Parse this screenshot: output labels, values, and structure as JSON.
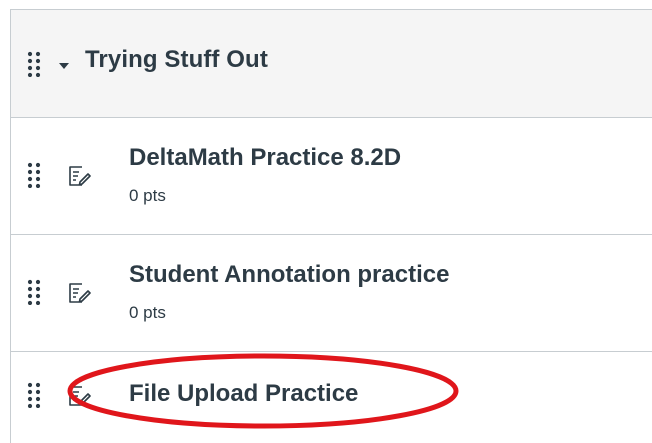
{
  "module": {
    "title": "Trying Stuff Out",
    "collapse_icon": "caret-down-icon",
    "drag_icon": "drag-handle-icon"
  },
  "items": [
    {
      "title": "DeltaMath Practice 8.2D",
      "points": "0 pts",
      "icon": "assignment-icon"
    },
    {
      "title": "Student Annotation practice",
      "points": "0 pts",
      "icon": "assignment-icon"
    },
    {
      "title": "File Upload Practice",
      "points": "",
      "icon": "assignment-icon",
      "annotated": true
    }
  ],
  "colors": {
    "text": "#2d3b45",
    "header_bg": "#f5f5f5",
    "border": "#c7cdd1",
    "annotation": "#e0161b"
  }
}
